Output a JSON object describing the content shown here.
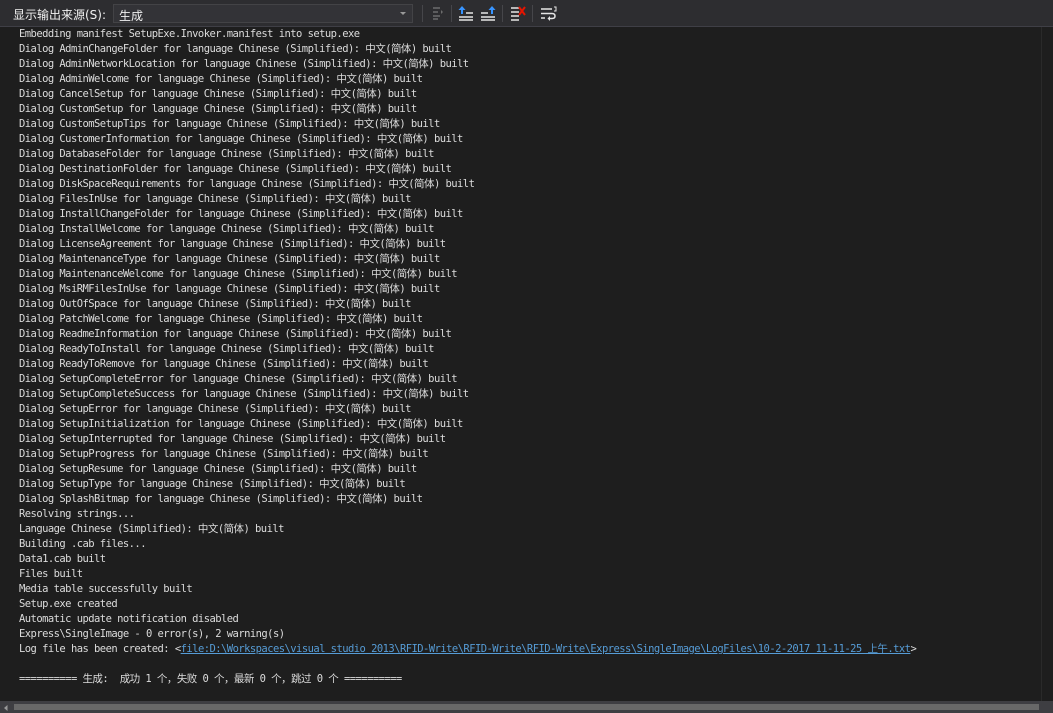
{
  "toolbar": {
    "source_label": "显示输出来源(S):",
    "source_value": "生成",
    "buttons": [
      {
        "name": "goto-prev-message-button",
        "icon": "find-message-icon"
      },
      {
        "name": "goto-prev-line-button",
        "icon": "go-previous-icon"
      },
      {
        "name": "goto-next-line-button",
        "icon": "go-next-icon"
      },
      {
        "name": "clear-all-button",
        "icon": "clear-all-icon"
      },
      {
        "name": "toggle-word-wrap-button",
        "icon": "word-wrap-icon"
      }
    ]
  },
  "output": {
    "lines": [
      "Embedding manifest SetupExe.Invoker.manifest into setup.exe",
      "Dialog AdminChangeFolder for language Chinese (Simplified): 中文(简体) built",
      "Dialog AdminNetworkLocation for language Chinese (Simplified): 中文(简体) built",
      "Dialog AdminWelcome for language Chinese (Simplified): 中文(简体) built",
      "Dialog CancelSetup for language Chinese (Simplified): 中文(简体) built",
      "Dialog CustomSetup for language Chinese (Simplified): 中文(简体) built",
      "Dialog CustomSetupTips for language Chinese (Simplified): 中文(简体) built",
      "Dialog CustomerInformation for language Chinese (Simplified): 中文(简体) built",
      "Dialog DatabaseFolder for language Chinese (Simplified): 中文(简体) built",
      "Dialog DestinationFolder for language Chinese (Simplified): 中文(简体) built",
      "Dialog DiskSpaceRequirements for language Chinese (Simplified): 中文(简体) built",
      "Dialog FilesInUse for language Chinese (Simplified): 中文(简体) built",
      "Dialog InstallChangeFolder for language Chinese (Simplified): 中文(简体) built",
      "Dialog InstallWelcome for language Chinese (Simplified): 中文(简体) built",
      "Dialog LicenseAgreement for language Chinese (Simplified): 中文(简体) built",
      "Dialog MaintenanceType for language Chinese (Simplified): 中文(简体) built",
      "Dialog MaintenanceWelcome for language Chinese (Simplified): 中文(简体) built",
      "Dialog MsiRMFilesInUse for language Chinese (Simplified): 中文(简体) built",
      "Dialog OutOfSpace for language Chinese (Simplified): 中文(简体) built",
      "Dialog PatchWelcome for language Chinese (Simplified): 中文(简体) built",
      "Dialog ReadmeInformation for language Chinese (Simplified): 中文(简体) built",
      "Dialog ReadyToInstall for language Chinese (Simplified): 中文(简体) built",
      "Dialog ReadyToRemove for language Chinese (Simplified): 中文(简体) built",
      "Dialog SetupCompleteError for language Chinese (Simplified): 中文(简体) built",
      "Dialog SetupCompleteSuccess for language Chinese (Simplified): 中文(简体) built",
      "Dialog SetupError for language Chinese (Simplified): 中文(简体) built",
      "Dialog SetupInitialization for language Chinese (Simplified): 中文(简体) built",
      "Dialog SetupInterrupted for language Chinese (Simplified): 中文(简体) built",
      "Dialog SetupProgress for language Chinese (Simplified): 中文(简体) built",
      "Dialog SetupResume for language Chinese (Simplified): 中文(简体) built",
      "Dialog SetupType for language Chinese (Simplified): 中文(简体) built",
      "Dialog SplashBitmap for language Chinese (Simplified): 中文(简体) built",
      "Resolving strings...",
      "Language Chinese (Simplified): 中文(简体) built",
      "Building .cab files...",
      "Data1.cab built",
      "Files built",
      "Media table successfully built",
      "Setup.exe created",
      "Automatic update notification disabled",
      "Express\\SingleImage - 0 error(s), 2 warning(s)"
    ],
    "log_prefix": "Log file has been created: ",
    "log_open": "<",
    "log_link": "file:D:\\Workspaces\\visual studio 2013\\RFID-Write\\RFID-Write\\RFID-Write\\Express\\SingleImage\\LogFiles\\10-2-2017 11-11-25 上午.txt",
    "log_close": ">",
    "summary": "========== 生成:  成功 1 个，失败 0 个，最新 0 个，跳过 0 个 =========="
  },
  "colors": {
    "background": "#1e1e1e",
    "toolbar": "#2d2d30",
    "text": "#dcdcdc",
    "link": "#569cd6"
  }
}
